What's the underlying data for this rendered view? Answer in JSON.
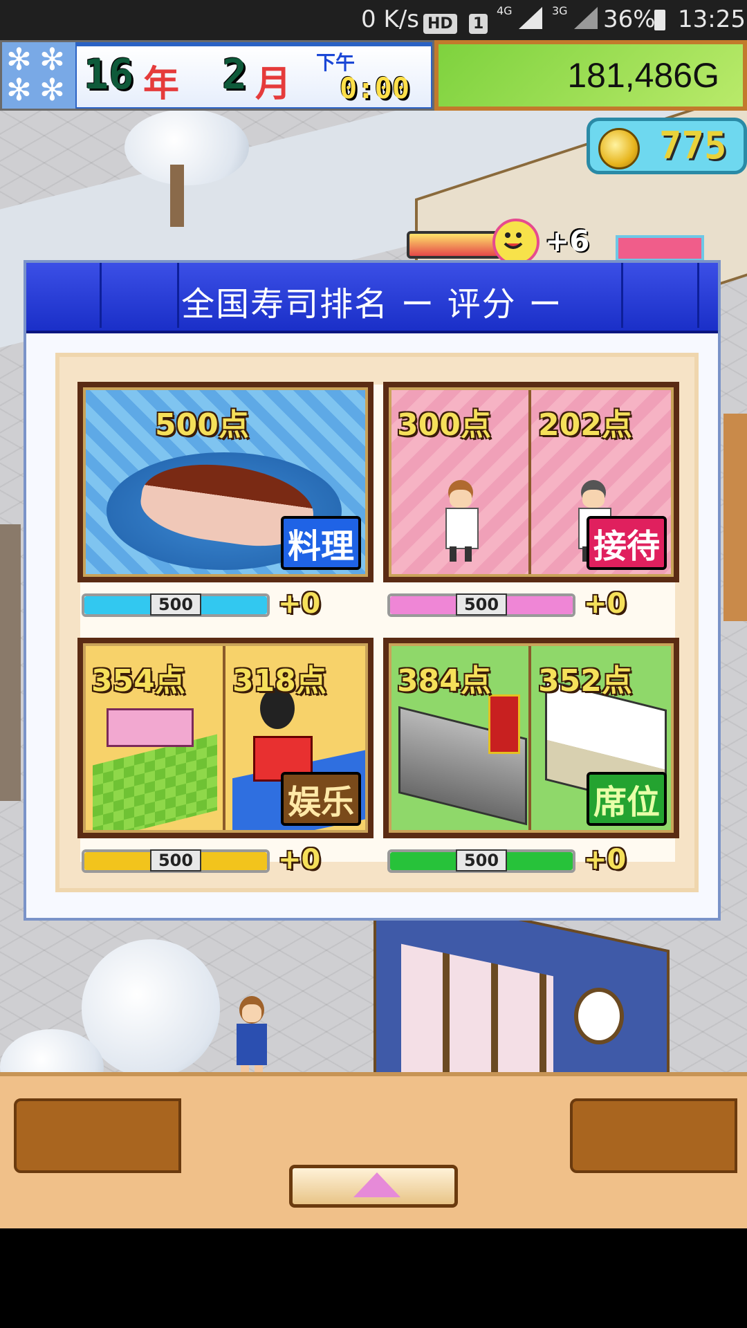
{
  "status_bar": {
    "net_speed": "0 K/s",
    "hd": "HD",
    "sim": "1",
    "net1": "4G",
    "net2": "3G",
    "battery": "36%",
    "time": "13:25"
  },
  "hud": {
    "year_num": "16",
    "year_unit": "年",
    "month_num": "2",
    "month_unit": "月",
    "period": "下午",
    "clock": "0:00",
    "money": "181,486G",
    "coins": "775",
    "faces_gain": "+6"
  },
  "dialog": {
    "title": "全国寿司排名 ー 评分 ー",
    "cards": [
      {
        "category": "料理",
        "points": [
          "500点"
        ],
        "bar_value": "500",
        "gain": "+0",
        "bar_color": "#32c8f0"
      },
      {
        "category": "接待",
        "points": [
          "300点",
          "202点"
        ],
        "bar_value": "500",
        "gain": "+0",
        "bar_color": "#ef86d6"
      },
      {
        "category": "娱乐",
        "points": [
          "354点",
          "318点"
        ],
        "bar_value": "500",
        "gain": "+0",
        "bar_color": "#f2c41c"
      },
      {
        "category": "席位",
        "points": [
          "384点",
          "352点"
        ],
        "bar_value": "500",
        "gain": "+0",
        "bar_color": "#27c23a"
      }
    ]
  },
  "colors": {
    "dialog_header": "#2238d6",
    "tag_cuisine": "#1f63e6",
    "tag_service": "#e0205e",
    "tag_fun": "#7a4a1a",
    "tag_seat": "#24a330"
  }
}
